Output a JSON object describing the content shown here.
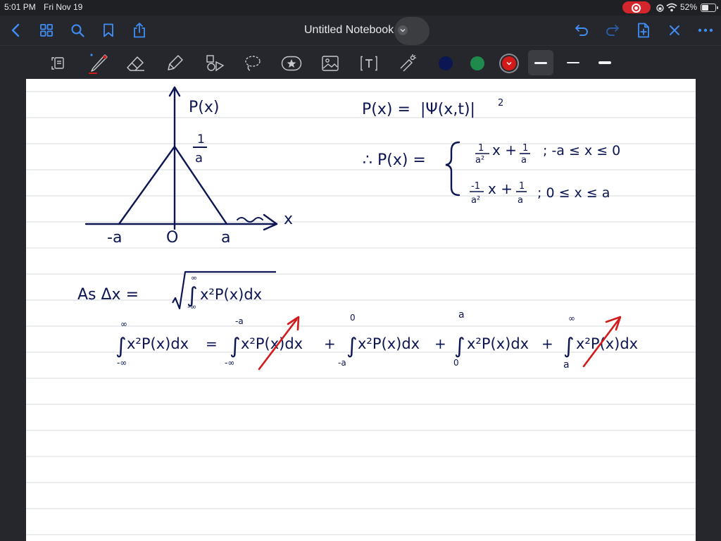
{
  "status_bar": {
    "time": "5:01 PM",
    "date": "Fri Nov 19",
    "battery_percent": "52%",
    "battery_level": 0.52
  },
  "nav": {
    "title": "Untitled Notebook",
    "left_icons": [
      "back-icon",
      "grid-icon",
      "search-icon",
      "bookmark-icon",
      "share-icon"
    ],
    "right_icons": [
      "undo-icon",
      "redo-icon",
      "add-page-icon",
      "close-icon",
      "more-icon"
    ]
  },
  "toolbar": {
    "tools": [
      "scan-icon",
      "pen-icon",
      "eraser-icon",
      "highlighter-icon",
      "shapes-icon",
      "lasso-icon",
      "sticker-icon",
      "image-icon",
      "text-icon",
      "laser-icon"
    ],
    "selected_tool": "pen",
    "colors": [
      "#0c1652",
      "#1e8a4c",
      "#d31a1a"
    ],
    "selected_color": "#d31a1a",
    "thickness_options": [
      "thin",
      "medium",
      "thick"
    ],
    "selected_thickness": "thin"
  },
  "notes": {
    "graph_ylabel": "P(x)",
    "graph_xlabel": "x",
    "graph_peak_label_num": "1",
    "graph_peak_label_den": "a",
    "graph_tick_neg_a": "-a",
    "graph_tick_zero": "O",
    "graph_tick_a": "a",
    "eq1_lhs": "P(x) =",
    "eq1_rhs": "|Ψ(x,t)|",
    "eq1_exp": "2",
    "eq2_lhs": "∴ P(x) =",
    "case1_condition": "; -a ≤ x ≤ 0",
    "case2_condition": "; 0 ≤ x ≤ a",
    "delta_x": "As   Δx =",
    "integrand": "x²P(x)dx",
    "inf": "∞",
    "neg_inf": "-∞",
    "neg_a": "-a",
    "zero": "0",
    "a": "a",
    "equals": "=",
    "plus": "+"
  }
}
